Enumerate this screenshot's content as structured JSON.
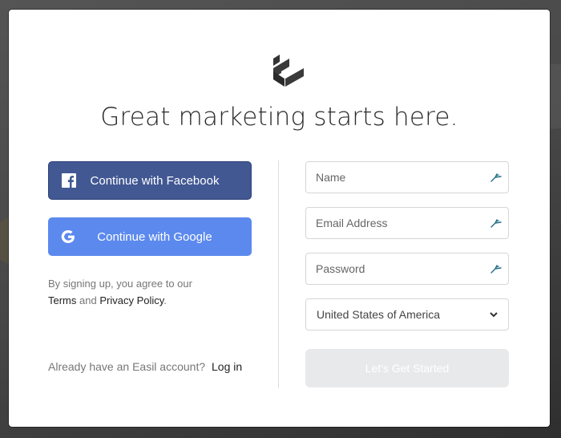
{
  "headline": "Great marketing starts here.",
  "social": {
    "facebook_label": "Continue with Facebook",
    "google_label": "Continue with Google",
    "facebook_color": "#425893",
    "google_color": "#5b89ee"
  },
  "legal": {
    "prefix": "By signing up, you agree to our",
    "terms": "Terms",
    "and": "and",
    "privacy": "Privacy Policy",
    "suffix": "."
  },
  "login": {
    "prompt": "Already have an Easil account?",
    "link": "Log in"
  },
  "form": {
    "name_placeholder": "Name",
    "email_placeholder": "Email Address",
    "password_placeholder": "Password",
    "country_selected": "United States of America",
    "submit_label": "Let's Get Started"
  }
}
